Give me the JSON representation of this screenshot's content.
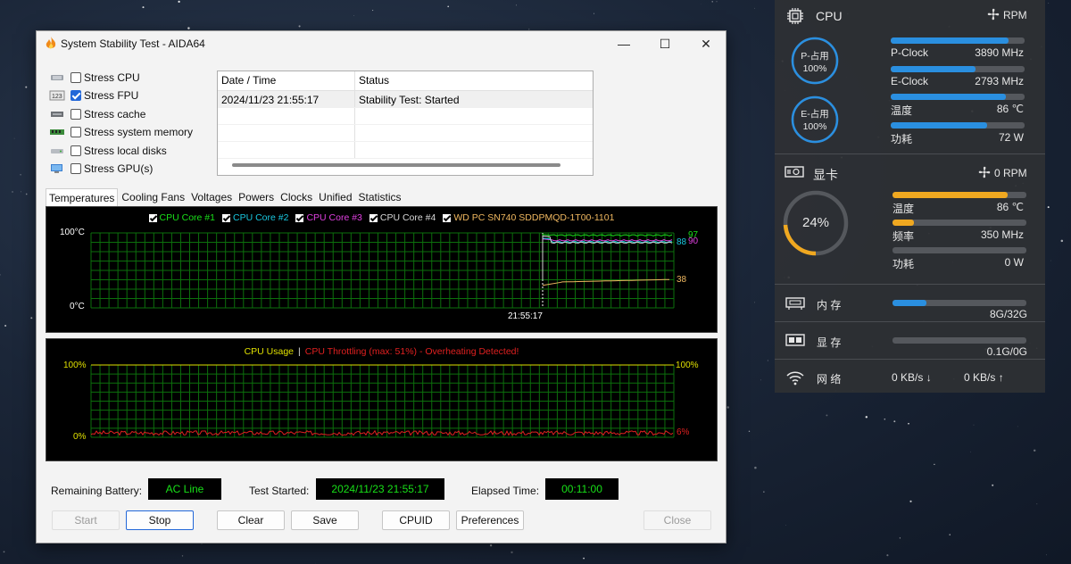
{
  "window": {
    "title": "System Stability Test - AIDA64",
    "controls": {
      "minimize": "—",
      "maximize": "☐",
      "close": "✕"
    }
  },
  "stress": [
    {
      "label": "Stress CPU",
      "checked": false,
      "icon": "cpu-chip-icon"
    },
    {
      "label": "Stress FPU",
      "checked": true,
      "icon": "fpu-icon"
    },
    {
      "label": "Stress cache",
      "checked": false,
      "icon": "cache-icon"
    },
    {
      "label": "Stress system memory",
      "checked": false,
      "icon": "memory-icon"
    },
    {
      "label": "Stress local disks",
      "checked": false,
      "icon": "disk-icon"
    },
    {
      "label": "Stress GPU(s)",
      "checked": false,
      "icon": "gpu-icon"
    }
  ],
  "log": {
    "headers": [
      "Date / Time",
      "Status"
    ],
    "rows": [
      {
        "time": "2024/11/23 21:55:17",
        "status": "Stability Test: Started"
      }
    ]
  },
  "tabs": [
    "Temperatures",
    "Cooling Fans",
    "Voltages",
    "Powers",
    "Clocks",
    "Unified",
    "Statistics"
  ],
  "temp_graph": {
    "legend": [
      {
        "label": "CPU Core #1",
        "color": "#19e019"
      },
      {
        "label": "CPU Core #2",
        "color": "#19c8e0"
      },
      {
        "label": "CPU Core #3",
        "color": "#e040e0"
      },
      {
        "label": "CPU Core #4",
        "color": "#d8d8d8"
      },
      {
        "label": "WD PC SN740 SDDPMQD-1T00-1101",
        "color": "#f0b860"
      }
    ],
    "y_top": "100°C",
    "y_bottom": "0°C",
    "x_label": "21:55:17",
    "end_values": [
      {
        "text": "97",
        "color": "#19e019"
      },
      {
        "text": "88",
        "color": "#19c8e0"
      },
      {
        "text": "90",
        "color": "#e040e0"
      },
      {
        "text": "38",
        "color": "#f0b860"
      }
    ]
  },
  "usage_graph": {
    "title_usage": "CPU Usage",
    "separator": "|",
    "title_throttle": "CPU Throttling (max: 51%) - Overheating Detected!",
    "y_top_left": "100%",
    "y_bottom_left": "0%",
    "y_top_right": "100%",
    "current_value": "6%",
    "colors": {
      "usage": "#e0e000",
      "throttle": "#e02020"
    }
  },
  "status": {
    "battery_label": "Remaining Battery:",
    "battery_value": "AC Line",
    "started_label": "Test Started:",
    "started_value": "2024/11/23 21:55:17",
    "elapsed_label": "Elapsed Time:",
    "elapsed_value": "00:11:00"
  },
  "buttons": {
    "start": "Start",
    "stop": "Stop",
    "clear": "Clear",
    "save": "Save",
    "cpuid": "CPUID",
    "preferences": "Preferences",
    "close": "Close"
  },
  "monitor": {
    "cpu": {
      "title": "CPU",
      "fan": "RPM",
      "p_ring": {
        "label": "P-占用",
        "value": "100%",
        "level": 1.0
      },
      "e_ring": {
        "label": "E-占用",
        "value": "100%",
        "level": 1.0
      },
      "rows": [
        {
          "label": "P-Clock",
          "value": "3890 MHz",
          "level": 0.88
        },
        {
          "label": "E-Clock",
          "value": "2793 MHz",
          "level": 0.63
        },
        {
          "label": "温度",
          "value": "86 ℃",
          "level": 0.86
        },
        {
          "label": "功耗",
          "value": "72 W",
          "level": 0.72
        }
      ],
      "accent": "#2a8fe0"
    },
    "gpu": {
      "title": "显卡",
      "fan": "0 RPM",
      "ring": {
        "value": "24%",
        "level": 0.24
      },
      "rows": [
        {
          "label": "温度",
          "value": "86 ℃",
          "level": 0.86
        },
        {
          "label": "频率",
          "value": "350 MHz",
          "level": 0.16
        },
        {
          "label": "功耗",
          "value": "0 W",
          "level": 0.0
        }
      ],
      "accent": "#f0a820"
    },
    "memory": {
      "label": "内 存",
      "value": "8G/32G",
      "level": 0.25
    },
    "vram": {
      "label": "显 存",
      "value": "0.1G/0G",
      "level": 0.0
    },
    "network": {
      "label": "网 络",
      "down": "0 KB/s",
      "down_arrow": "↓",
      "up": "0 KB/s",
      "up_arrow": "↑"
    }
  }
}
